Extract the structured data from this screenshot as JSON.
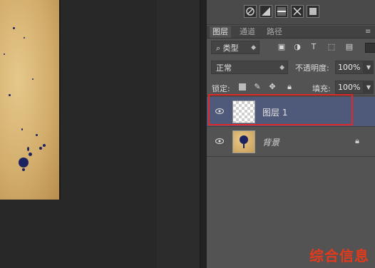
{
  "layers_panel": {
    "tabs": [
      {
        "label": "图层",
        "active": true
      },
      {
        "label": "通道",
        "active": false
      },
      {
        "label": "路径",
        "active": false
      }
    ],
    "filter": {
      "kind_label": "类型",
      "search_icon": "search-icon"
    },
    "blend_mode": "正常",
    "opacity_label": "不透明度:",
    "opacity_value": "100%",
    "lock_label": "锁定:",
    "fill_label": "填充:",
    "fill_value": "100%",
    "layers": [
      {
        "name": "图层 1",
        "selected": true,
        "visible": true,
        "thumbnail": "transparent"
      },
      {
        "name": "背景",
        "selected": false,
        "visible": true,
        "thumbnail": "ink-splash",
        "locked": true
      }
    ]
  },
  "watermark": "综合信息",
  "colors": {
    "panel_bg": "#535353",
    "selected_row": "#4f5a7a",
    "highlight_border": "#e0282a",
    "watermark": "#e43a1c"
  }
}
